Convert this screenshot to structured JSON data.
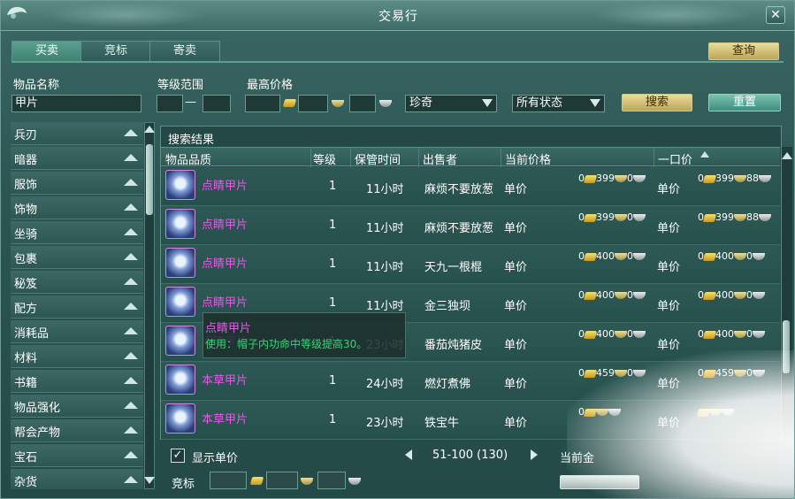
{
  "window": {
    "title": "交易行",
    "close": "✕"
  },
  "tabs": [
    "买卖",
    "竞标",
    "寄卖"
  ],
  "query_button": "查询",
  "filters": {
    "name_label": "物品名称",
    "name_value": "甲片",
    "level_label": "等级范围",
    "level_sep": "—",
    "max_price_label": "最高价格",
    "rarity": "珍奇",
    "status": "所有状态",
    "search_button": "搜索",
    "reset_button": "重置"
  },
  "categories": [
    "兵刃",
    "暗器",
    "服饰",
    "饰物",
    "坐骑",
    "包裹",
    "秘笈",
    "配方",
    "消耗品",
    "材料",
    "书籍",
    "物品强化",
    "帮会产物",
    "宝石",
    "杂货"
  ],
  "results": {
    "title": "搜索结果",
    "columns": [
      "物品品质",
      "等级",
      "保管时间",
      "出售者",
      "当前价格",
      "一口价"
    ],
    "unit_label": "单价",
    "rows": [
      {
        "name": "点睛甲片",
        "level": "1",
        "time": "11小时",
        "seller": "麻烦不要放葱",
        "cur": [
          "0",
          "399",
          "0"
        ],
        "buy": [
          "0",
          "399",
          "88"
        ]
      },
      {
        "name": "点睛甲片",
        "level": "1",
        "time": "11小时",
        "seller": "麻烦不要放葱",
        "cur": [
          "0",
          "399",
          "0"
        ],
        "buy": [
          "0",
          "399",
          "88"
        ]
      },
      {
        "name": "点睛甲片",
        "level": "1",
        "time": "11小时",
        "seller": "天九一根棍",
        "cur": [
          "0",
          "400",
          "0"
        ],
        "buy": [
          "0",
          "400",
          "0"
        ]
      },
      {
        "name": "点睛甲片",
        "level": "1",
        "time": "11小时",
        "seller": "金三独坝",
        "cur": [
          "0",
          "400",
          "0"
        ],
        "buy": [
          "0",
          "400",
          "0"
        ]
      },
      {
        "name": "点睛甲片",
        "level": "1",
        "time": "23小时",
        "seller": "番茄炖猪皮",
        "cur": [
          "0",
          "400",
          "0"
        ],
        "buy": [
          "0",
          "400",
          "0"
        ]
      },
      {
        "name": "本草甲片",
        "level": "1",
        "time": "24小时",
        "seller": "燃灯煮佛",
        "cur": [
          "0",
          "459",
          "0"
        ],
        "buy": [
          "0",
          "459",
          "0"
        ]
      },
      {
        "name": "本草甲片",
        "level": "1",
        "time": "23小时",
        "seller": "铁宝牛",
        "cur": [
          "0",
          "",
          ""
        ],
        "buy": [
          "",
          "",
          ""
        ]
      }
    ]
  },
  "tooltip": {
    "name": "点睛甲片",
    "use": "使用：帽子内功命中等级提高30。"
  },
  "footer": {
    "show_unit_price": "显示单价",
    "checked": "✓",
    "pagination": "51-100 (130)",
    "current_gold_label": "当前金",
    "bid_label": "竞标"
  }
}
